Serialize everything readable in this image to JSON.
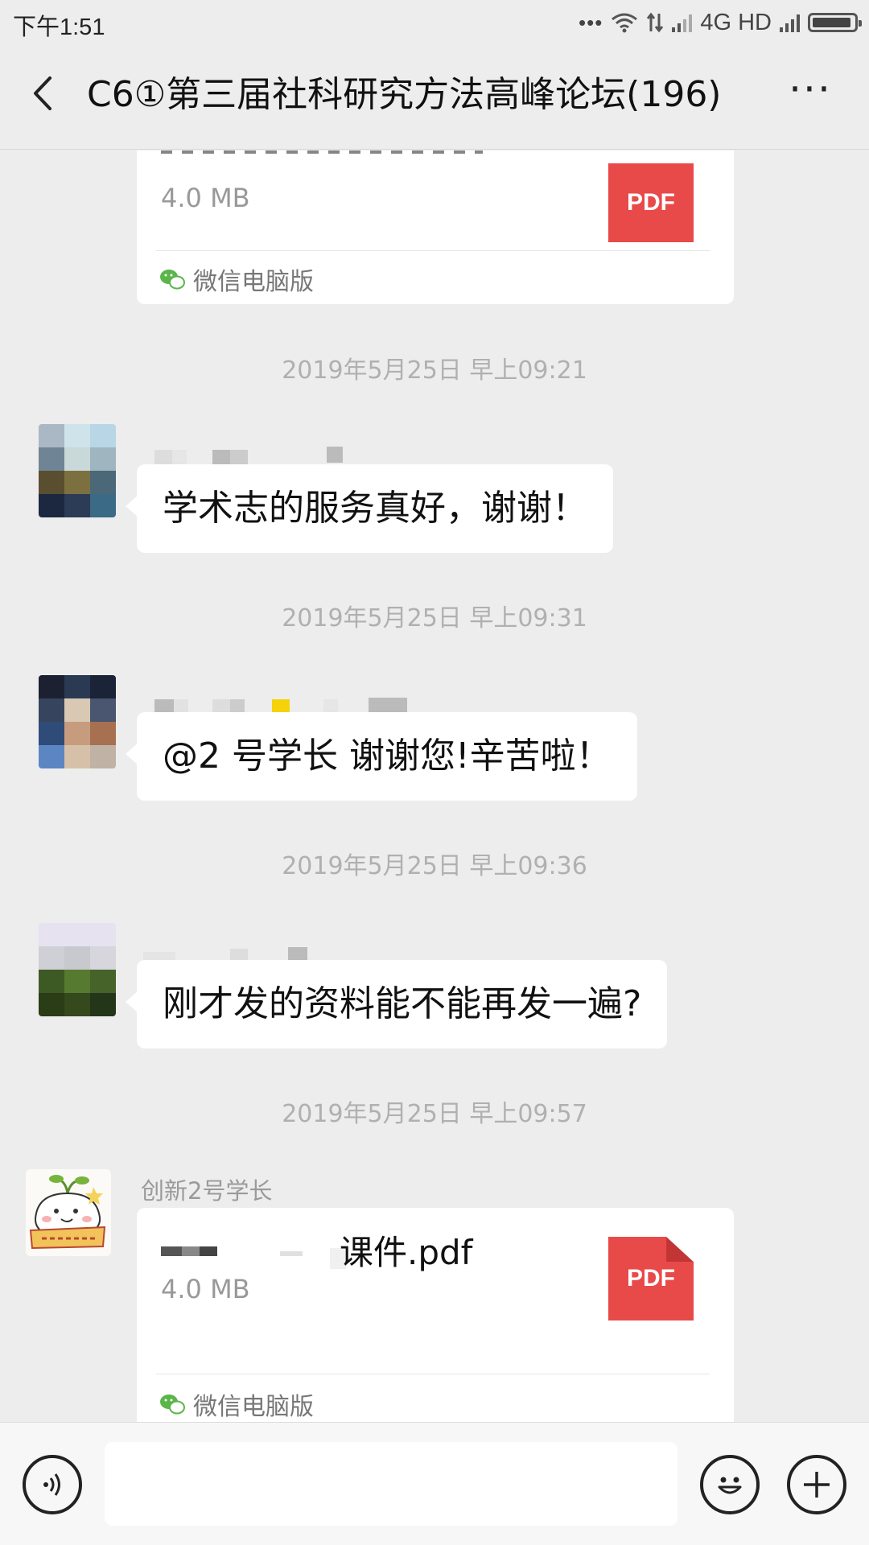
{
  "status_bar": {
    "time": "下午1:51",
    "network": "4G HD",
    "icons": [
      "more-dots-icon",
      "wifi-icon",
      "data-arrows-icon",
      "signal-icon",
      "signal-icon",
      "battery-icon"
    ]
  },
  "header": {
    "title": "C6①第三届社科研究方法高峰论坛(196)",
    "back_icon": "chevron-left-icon",
    "more_label": "···"
  },
  "messages": {
    "file1": {
      "size": "4.0 MB",
      "icon_label": "PDF",
      "source": "微信电脑版"
    },
    "time1": "2019年5月25日 早上09:21",
    "msg1": {
      "text": "学术志的服务真好，谢谢！"
    },
    "time2": "2019年5月25日 早上09:31",
    "msg2": {
      "text": "@2 号学长  谢谢您!辛苦啦！"
    },
    "time3": "2019年5月25日 早上09:36",
    "msg3": {
      "text": "刚才发的资料能不能再发一遍?"
    },
    "time4": "2019年5月25日 早上09:57",
    "file2": {
      "sender": "创新2号学长",
      "name_suffix": "课件.pdf",
      "size": "4.0 MB",
      "icon_label": "PDF",
      "source": "微信电脑版"
    }
  },
  "input_bar": {
    "voice_icon": "voice-icon",
    "emoji_icon": "emoji-icon",
    "plus_icon": "plus-icon"
  },
  "colors": {
    "background": "#ededed",
    "pdf_red": "#e84a4a",
    "wechat_green": "#5bb54a"
  }
}
